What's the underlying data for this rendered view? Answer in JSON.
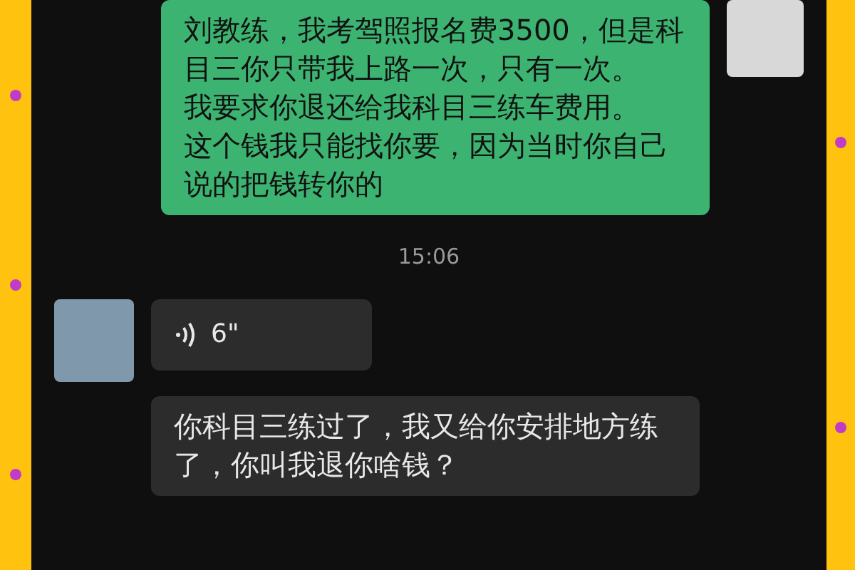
{
  "messages": [
    {
      "kind": "text",
      "outgoing": true,
      "lines": [
        "刘教练，我考驾照报名费3500，但是科目三你只带我上路一次，只有一次。",
        "我要求你退还给我科目三练车费用。",
        "这个钱我只能找你要，因为当时你自己说的把钱转你的"
      ]
    },
    {
      "kind": "time",
      "text": "15:06"
    },
    {
      "kind": "voice",
      "outgoing": false,
      "duration": "6\""
    },
    {
      "kind": "text",
      "outgoing": false,
      "lines": [
        "你科目三练过了，我又给你安排地方练了，你叫我退你啥钱？"
      ]
    }
  ]
}
